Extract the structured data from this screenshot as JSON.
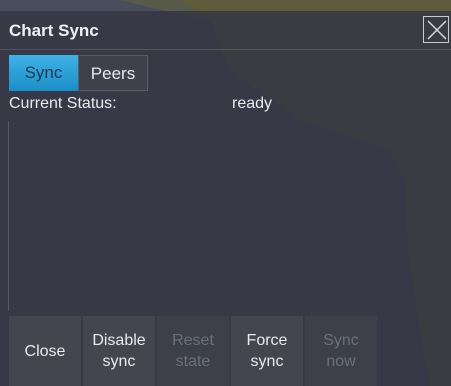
{
  "dialog": {
    "title": "Chart Sync",
    "close_icon": "close-icon"
  },
  "tabs": [
    {
      "label": "Sync",
      "active": true
    },
    {
      "label": "Peers",
      "active": false
    }
  ],
  "status": {
    "label": "Current Status:",
    "value": "ready"
  },
  "buttons": [
    {
      "label": "Close",
      "enabled": true
    },
    {
      "label": "Disable\nsync",
      "enabled": true
    },
    {
      "label": "Reset\nstate",
      "enabled": false
    },
    {
      "label": "Force\nsync",
      "enabled": true
    },
    {
      "label": "Sync\nnow",
      "enabled": false
    }
  ],
  "colors": {
    "accent": "#2aa3dc",
    "land": "#5d5a3d",
    "water": "#464a5b"
  }
}
